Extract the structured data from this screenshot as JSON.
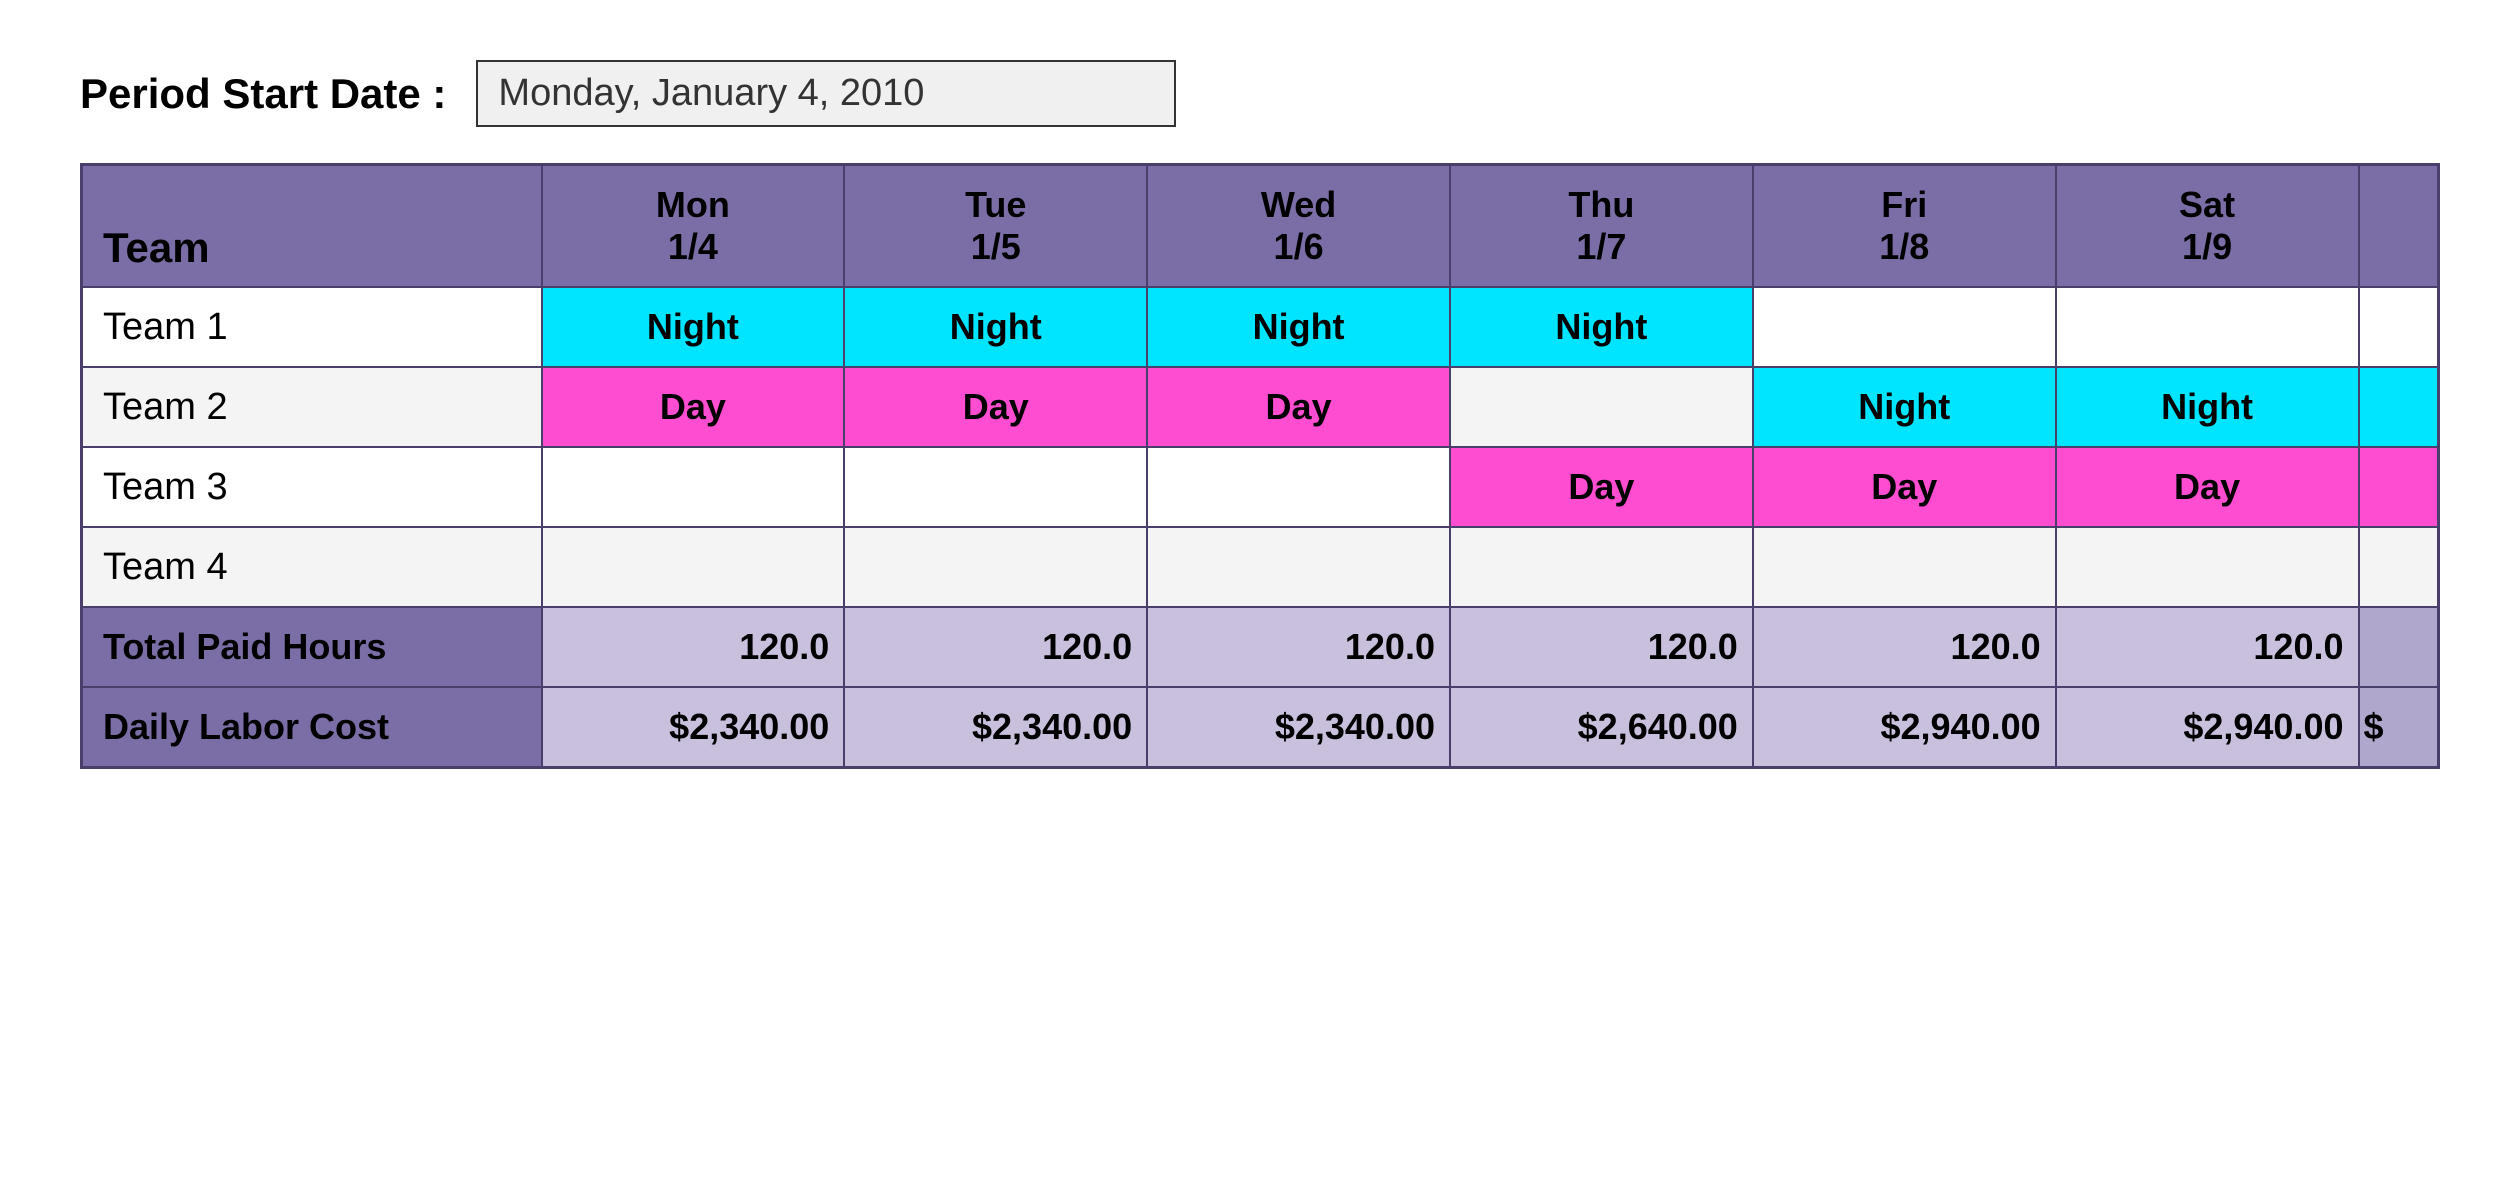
{
  "period": {
    "label": "Period Start Date :",
    "value": "Monday, January 4, 2010"
  },
  "table": {
    "headers": {
      "team": "Team",
      "days": [
        {
          "day": "Mon",
          "date": "1/4"
        },
        {
          "day": "Tue",
          "date": "1/5"
        },
        {
          "day": "Wed",
          "date": "1/6"
        },
        {
          "day": "Thu",
          "date": "1/7"
        },
        {
          "day": "Fri",
          "date": "1/8"
        },
        {
          "day": "Sat",
          "date": "1/9"
        }
      ]
    },
    "teams": [
      {
        "name": "Team 1",
        "shifts": [
          "Night",
          "Night",
          "Night",
          "Night",
          "",
          ""
        ]
      },
      {
        "name": "Team 2",
        "shifts": [
          "Day",
          "Day",
          "Day",
          "",
          "Night",
          "Night"
        ]
      },
      {
        "name": "Team 3",
        "shifts": [
          "",
          "",
          "",
          "Day",
          "Day",
          "Day"
        ]
      },
      {
        "name": "Team 4",
        "shifts": [
          "",
          "",
          "",
          "",
          "",
          ""
        ]
      }
    ],
    "totals": {
      "label": "Total Paid Hours",
      "values": [
        "120.0",
        "120.0",
        "120.0",
        "120.0",
        "120.0",
        "120.0"
      ]
    },
    "costs": {
      "label": "Daily Labor Cost",
      "values": [
        "$2,340.00",
        "$2,340.00",
        "$2,340.00",
        "$2,640.00",
        "$2,940.00",
        "$2,940.00"
      ]
    }
  }
}
